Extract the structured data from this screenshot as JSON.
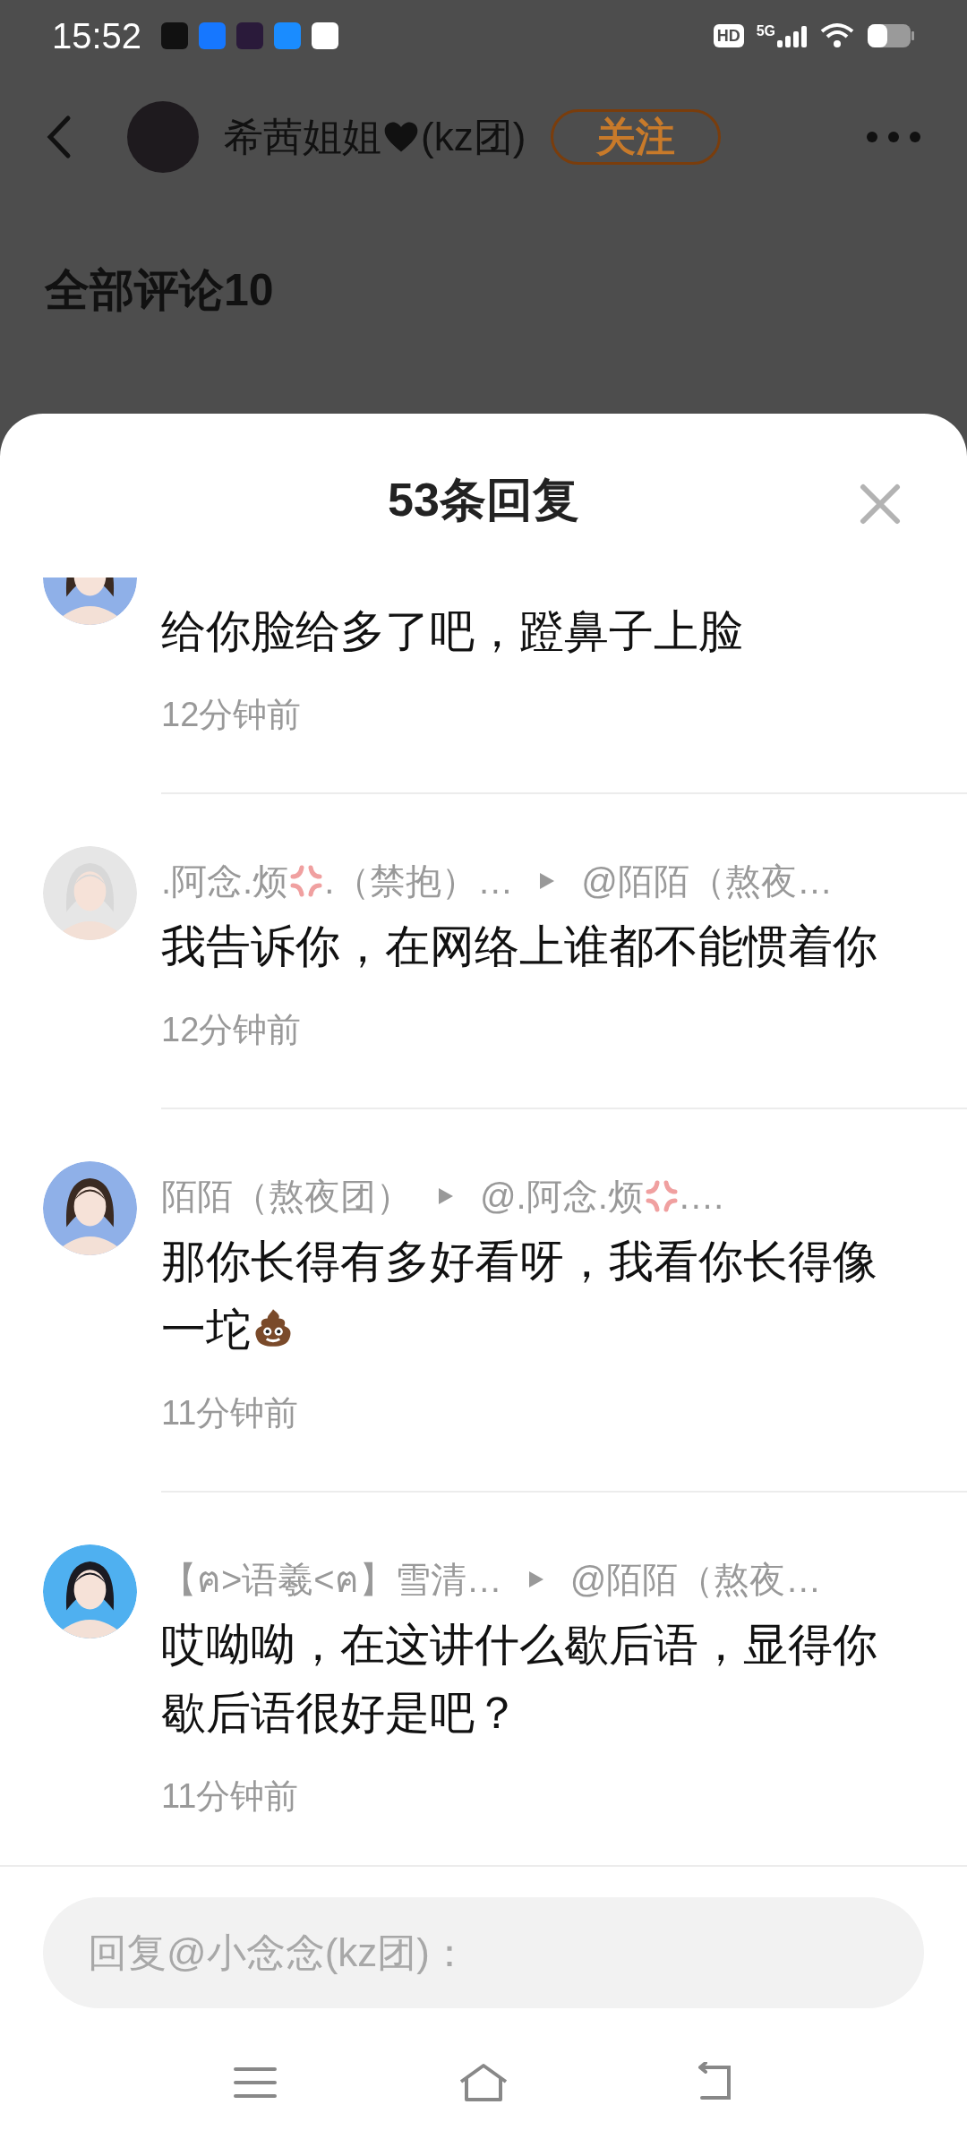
{
  "status_bar": {
    "time": "15:52",
    "apps": [
      {
        "color": "#111111"
      },
      {
        "color": "#1677ff"
      },
      {
        "color": "#2a1a3a"
      },
      {
        "color": "#1a8cff"
      },
      {
        "color": "#ffffff"
      }
    ],
    "hd": "HD",
    "network": "5G"
  },
  "header": {
    "name": [
      {
        "kind": "text",
        "text": "希茜姐姐"
      },
      {
        "kind": "heart"
      },
      {
        "kind": "text",
        "text": "(kz团)"
      }
    ],
    "follow": "关注"
  },
  "section_title": "全部评论10",
  "sheet": {
    "title": "53条回复",
    "replies": [
      {
        "text": [
          {
            "kind": "text",
            "text": "给你脸给多了吧，蹬鼻子上脸"
          }
        ],
        "time": "12分钟前"
      },
      {
        "name": [
          {
            "kind": "text",
            "text": ".阿念.烦"
          },
          {
            "kind": "anger"
          },
          {
            "kind": "text",
            "text": ".（禁抱）…"
          }
        ],
        "reply_to": [
          {
            "kind": "text",
            "text": "@陌陌（熬夜…"
          }
        ],
        "text": [
          {
            "kind": "text",
            "text": "我告诉你，在网络上谁都不能惯着你"
          }
        ],
        "time": "12分钟前"
      },
      {
        "name": [
          {
            "kind": "text",
            "text": "陌陌（熬夜团）"
          }
        ],
        "reply_to": [
          {
            "kind": "text",
            "text": "@.阿念.烦"
          },
          {
            "kind": "anger"
          },
          {
            "kind": "text",
            "text": ".…"
          }
        ],
        "text": [
          {
            "kind": "text",
            "text": "那你长得有多好看呀，我看你长得像一坨"
          },
          {
            "kind": "poop"
          }
        ],
        "time": "11分钟前"
      },
      {
        "name": [
          {
            "kind": "text",
            "text": "【ฅ>语羲<ฅ】雪清…"
          }
        ],
        "reply_to": [
          {
            "kind": "text",
            "text": "@陌陌（熬夜…"
          }
        ],
        "text": [
          {
            "kind": "text",
            "text": "哎呦呦，在这讲什么歇后语，显得你歇后语很好是吧？"
          }
        ],
        "time": "11分钟前"
      }
    ],
    "reply_field": {
      "placeholder": "回复@小念念(kz团)："
    }
  }
}
